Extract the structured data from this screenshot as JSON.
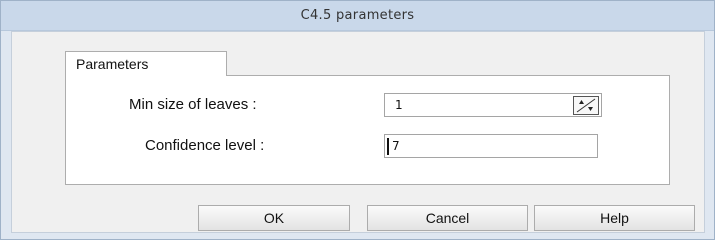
{
  "window": {
    "title": "C4.5 parameters"
  },
  "tabs": [
    {
      "label": "Parameters",
      "active": true
    }
  ],
  "fields": {
    "min_leaves": {
      "label": "Min size of leaves :",
      "value": "1"
    },
    "confidence": {
      "label": "Confidence level :",
      "value": "7"
    }
  },
  "icons": {
    "spin": "spin-up-down-icon"
  },
  "buttons": {
    "ok": "OK",
    "cancel": "Cancel",
    "help": "Help"
  },
  "colors": {
    "titlebar": "#c9d8ea",
    "frame": "#dfe7f1",
    "panel": "#ffffff"
  }
}
